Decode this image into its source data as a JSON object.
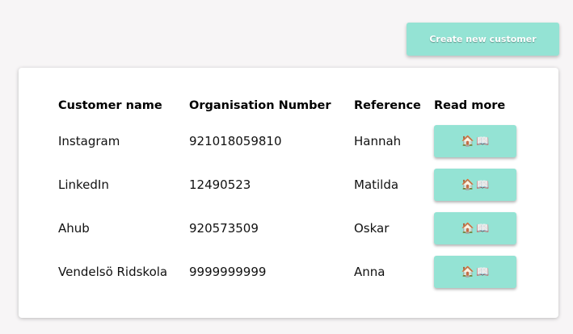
{
  "toolbar": {
    "create_label": "Create new customer"
  },
  "table": {
    "headers": [
      "Customer name",
      "Organisation Number",
      "Reference",
      "Read more"
    ],
    "rows": [
      {
        "name": "Instagram",
        "org": "921018059810",
        "reference": "Hannah"
      },
      {
        "name": "LinkedIn",
        "org": "12490523",
        "reference": "Matilda"
      },
      {
        "name": "Ahub",
        "org": "920573509",
        "reference": "Oskar"
      },
      {
        "name": "Vendelsö Ridskola",
        "org": "9999999999",
        "reference": "Anna"
      }
    ]
  },
  "icons": {
    "read_more": [
      "house-icon",
      "open-book-icon"
    ],
    "house_glyph": "🏠",
    "book_glyph": "📖"
  },
  "colors": {
    "accent": "#94e3d4",
    "page_background": "#f7f5f6",
    "card_background": "#ffffff"
  }
}
